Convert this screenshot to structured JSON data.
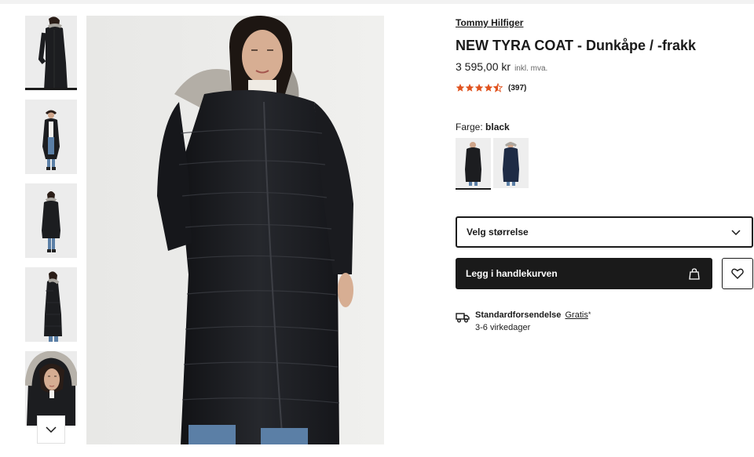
{
  "gallery": {
    "thumbnails": [
      {
        "name": "front view",
        "active": true
      },
      {
        "name": "full length open",
        "active": false
      },
      {
        "name": "back view",
        "active": false
      },
      {
        "name": "side view",
        "active": false
      },
      {
        "name": "hood closeup",
        "active": false
      }
    ],
    "scroll_down_icon": "chevron-down-icon"
  },
  "product": {
    "brand": "Tommy Hilfiger",
    "title": "NEW TYRA COAT - Dunkåpe / -frakk",
    "price": "3 595,00 kr",
    "vat_note": "inkl. mva.",
    "rating_stars": 4.5,
    "rating_count": "(397)",
    "star_color": "#e0531f"
  },
  "color": {
    "label": "Farge:",
    "selected": "black",
    "swatches": [
      {
        "name": "black",
        "hex": "#1c1d20",
        "selected": true
      },
      {
        "name": "navy",
        "hex": "#1e2b45",
        "selected": false
      }
    ]
  },
  "size": {
    "placeholder": "Velg størrelse",
    "icon": "chevron-down-icon"
  },
  "cart": {
    "label": "Legg i handlekurven",
    "icon": "shopping-bag-icon",
    "wishlist_icon": "heart-icon"
  },
  "shipping": {
    "title": "Standardforsendelse",
    "cost": "Gratis",
    "footnote": "*",
    "days": "3-6 virkedager",
    "icon": "truck-icon"
  }
}
